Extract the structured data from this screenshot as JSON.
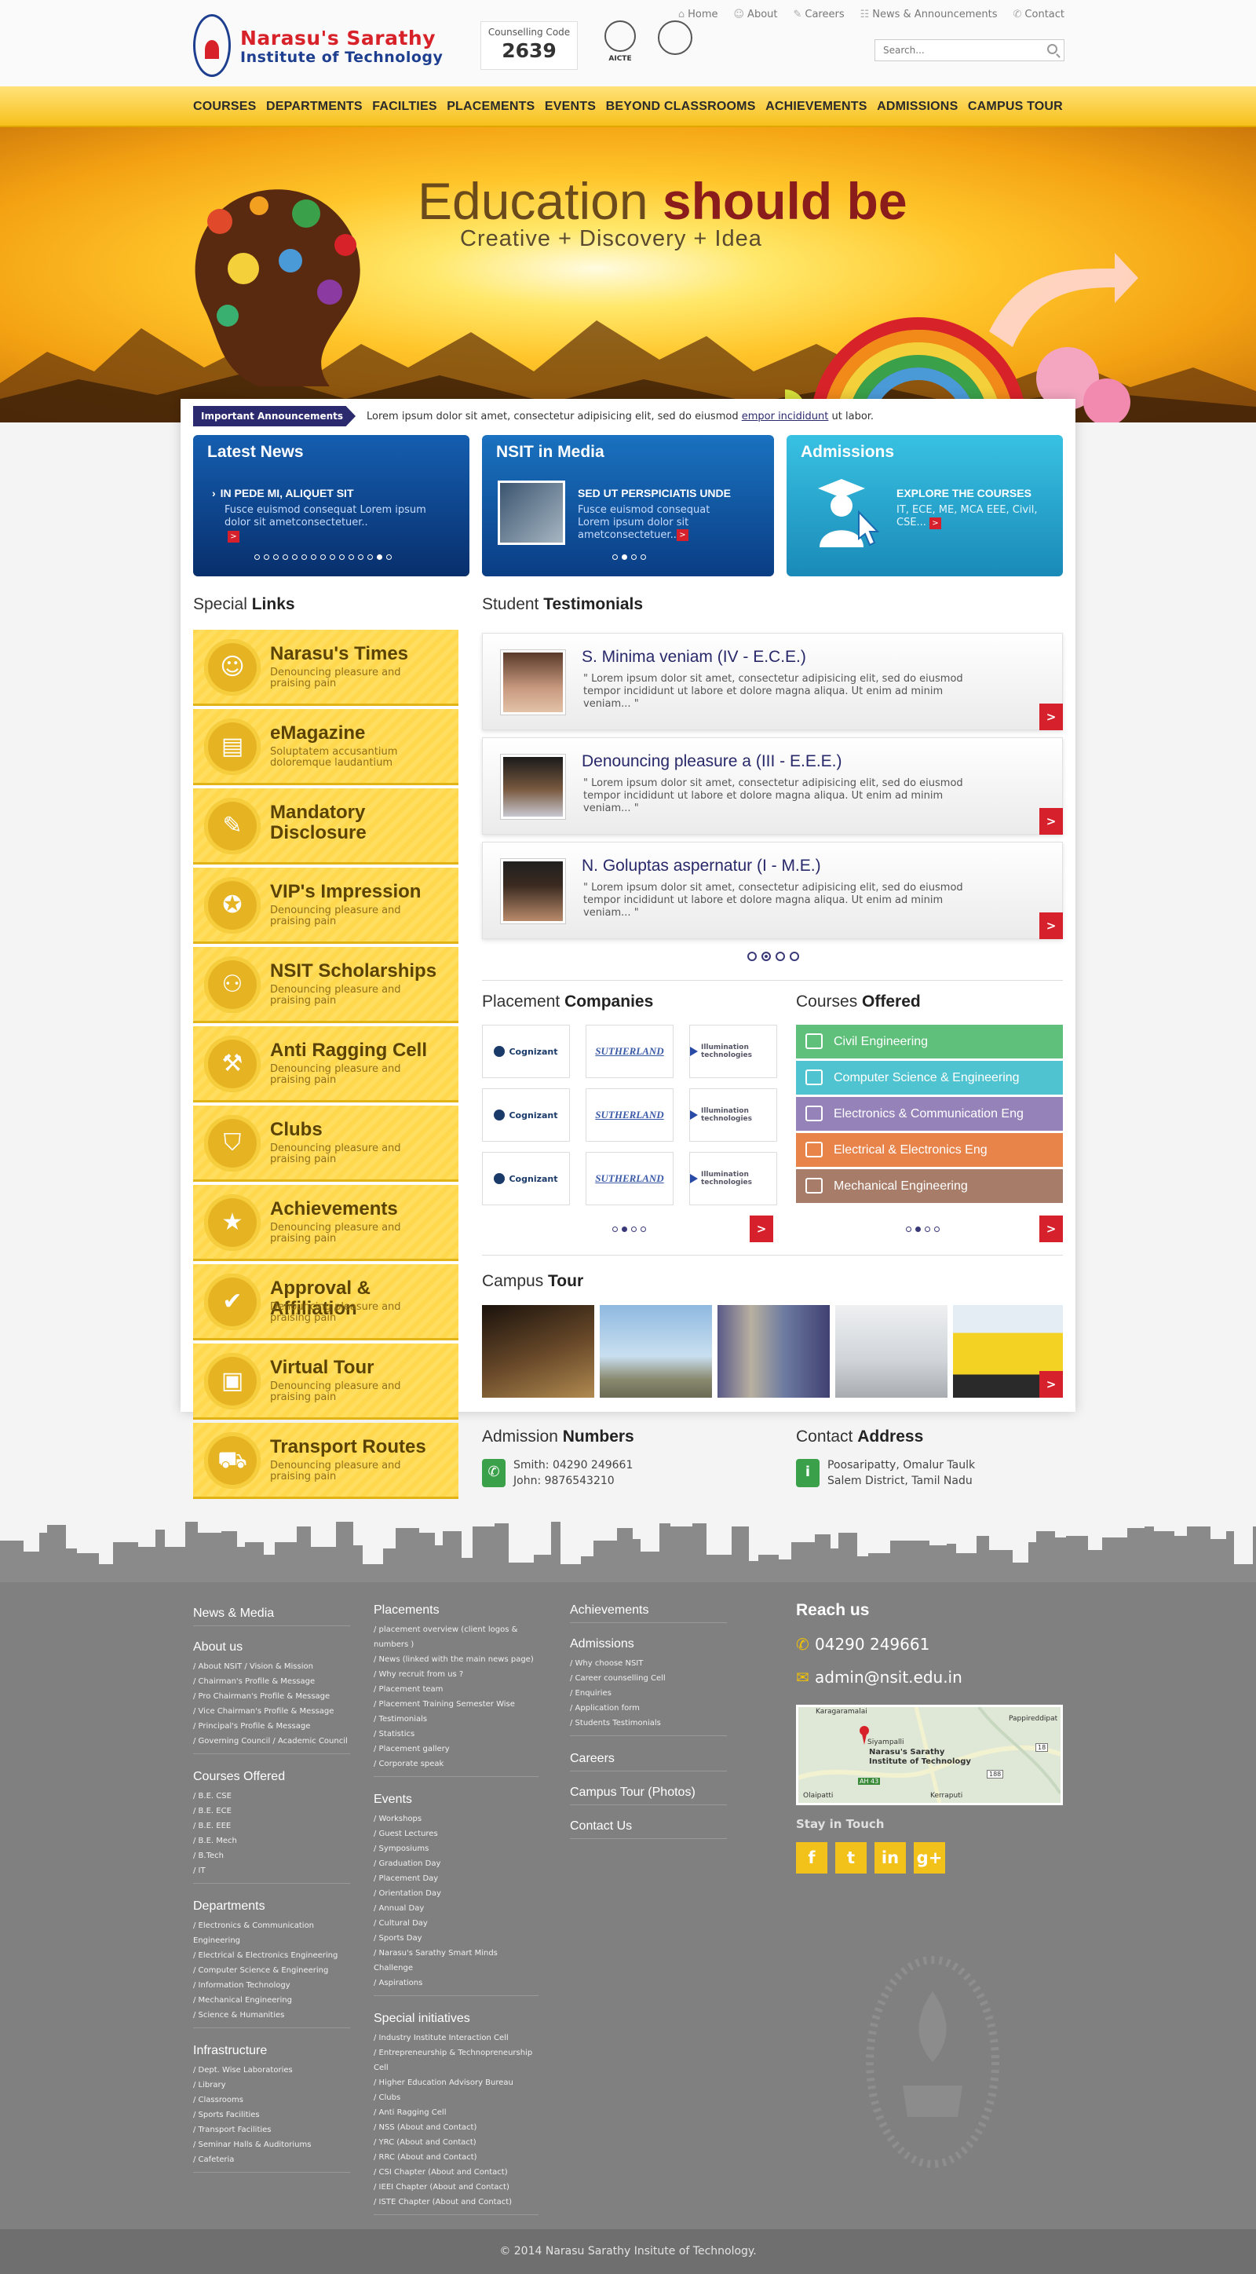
{
  "header": {
    "logo_line1": "Narasu's Sarathy",
    "logo_line2": "Institute of Technology",
    "counselling_label": "Counselling Code",
    "counselling_code": "2639",
    "seal_aicte": "AICTE",
    "top_links": [
      "Home",
      "About",
      "Careers",
      "News & Announcements",
      "Contact"
    ],
    "search_placeholder": "Search..."
  },
  "nav": [
    "COURSES",
    "DEPARTMENTS",
    "FACILTIES",
    "PLACEMENTS",
    "EVENTS",
    "BEYOND CLASSROOMS",
    "ACHIEVEMENTS",
    "ADMISSIONS",
    "CAMPUS TOUR"
  ],
  "hero": {
    "title_plain": "Education ",
    "title_bold": "should be",
    "subtitle": "Creative   +   Discovery   +   Idea"
  },
  "announcement": {
    "tag": "Important Announcements",
    "text_before": "Lorem ipsum dolor sit amet, consectetur adipisicing elit, sed do eiusmod ",
    "link": "empor incididunt",
    "text_after": " ut labor."
  },
  "panels": {
    "news": {
      "title": "Latest News",
      "item_title": "IN PEDE MI, ALIQUET SIT",
      "item_text": "Fusce euismod consequat Lorem ipsum dolor sit ametconsectetuer..",
      "more": ">",
      "dot_count": 15,
      "active_dot": 13
    },
    "media": {
      "title": "NSIT in Media",
      "item_title": "SED UT PERSPICIATIS UNDE",
      "item_text": "Fusce euismod consequat Lorem ipsum dolor sit ametconsectetuer..",
      "more": ">",
      "dot_count": 4,
      "active_dot": 1
    },
    "admissions": {
      "title": "Admissions",
      "item_title": "EXPLORE THE COURSES",
      "item_text": "IT, ECE, ME, MCA EEE, Civil, CSE...",
      "more": ">"
    }
  },
  "special_links": {
    "title_plain": "Special ",
    "title_bold": "Links",
    "items": [
      {
        "title": "Narasu's Times",
        "desc": "Denouncing pleasure and praising pain",
        "icon": "person-icon"
      },
      {
        "title": "eMagazine",
        "desc": "Soluptatem accusantium doloremque laudantium",
        "icon": "document-icon"
      },
      {
        "title": "Mandatory Disclosure",
        "desc": "",
        "icon": "edit-icon"
      },
      {
        "title": "VIP's Impression",
        "desc": "Denouncing pleasure and praising pain",
        "icon": "badge-icon"
      },
      {
        "title": "NSIT Scholarships",
        "desc": "Denouncing pleasure and praising pain",
        "icon": "scholarship-icon"
      },
      {
        "title": "Anti Ragging Cell",
        "desc": "Denouncing pleasure and praising pain",
        "icon": "gavel-icon"
      },
      {
        "title": "Clubs",
        "desc": "Denouncing pleasure and praising pain",
        "icon": "shield-icon"
      },
      {
        "title": "Achievements",
        "desc": "Denouncing pleasure and praising pain",
        "icon": "trophy-icon"
      },
      {
        "title": "Approval & Affiliation",
        "desc": "Denouncing pleasure and praising pain",
        "icon": "check-icon"
      },
      {
        "title": "Virtual Tour",
        "desc": "Denouncing pleasure and praising pain",
        "icon": "camera-icon"
      },
      {
        "title": "Transport Routes",
        "desc": "Denouncing pleasure and praising pain",
        "icon": "bus-icon"
      }
    ]
  },
  "testimonials": {
    "title_plain": "Student ",
    "title_bold": "Testimonials",
    "items": [
      {
        "name": "S. Minima veniam (IV - E.C.E.)",
        "quote": "\" Lorem ipsum dolor sit amet, consectetur adipisicing elit, sed do eiusmod tempor incididunt ut labore et dolore magna aliqua. Ut enim ad minim veniam... \""
      },
      {
        "name": "Denouncing pleasure a (III - E.E.E.)",
        "quote": "\" Lorem ipsum dolor sit amet, consectetur adipisicing elit, sed do eiusmod tempor incididunt ut labore et dolore magna aliqua. Ut enim ad minim veniam... \""
      },
      {
        "name": "N. Goluptas aspernatur (I - M.E.)",
        "quote": "\" Lorem ipsum dolor sit amet, consectetur adipisicing elit, sed do eiusmod tempor incididunt ut labore et dolore magna aliqua. Ut enim ad minim veniam... \""
      }
    ],
    "more": ">",
    "dot_count": 4,
    "active_dot": 1
  },
  "placement": {
    "title_plain": "Placement ",
    "title_bold": "Companies",
    "logos": [
      "Cognizant",
      "SUTHERLAND",
      "Illumination technologies",
      "Cognizant",
      "SUTHERLAND",
      "Illumination technologies",
      "Cognizant",
      "SUTHERLAND",
      "Illumination technologies"
    ],
    "more": ">",
    "dot_count": 4,
    "active_dot": 1
  },
  "courses": {
    "title_plain": "Courses ",
    "title_bold": "Offered",
    "items": [
      {
        "name": "Civil Engineering",
        "color": "#5ec07a"
      },
      {
        "name": "Computer Science & Engineering",
        "color": "#4fc3cf"
      },
      {
        "name": "Electronics & Communication Eng",
        "color": "#9582b9"
      },
      {
        "name": "Electrical & Electronics Eng",
        "color": "#e8834a"
      },
      {
        "name": "Mechanical Engineering",
        "color": "#a77d6a"
      }
    ],
    "more": ">",
    "dot_count": 4,
    "active_dot": 1
  },
  "campus_tour": {
    "title_plain": "Campus ",
    "title_bold": "Tour",
    "more": ">"
  },
  "admission_numbers": {
    "title_plain": "Admission ",
    "title_bold": "Numbers",
    "line1": "Smith: 04290 249661",
    "line2": "John: 9876543210"
  },
  "contact_address": {
    "title_plain": "Contact ",
    "title_bold": "Address",
    "line1": "Poosaripatty, Omalur Taulk",
    "line2": "Salem District, Tamil Nadu"
  },
  "footer": {
    "col1": [
      {
        "heading": "News & Media",
        "links": []
      },
      {
        "heading": "About us",
        "links": [
          "/ About NSIT   / Vision & Mission",
          "/ Chairman's Profile & Message",
          "/ Pro Chairman's Profile & Message",
          "/ Vice Chairman's Profile & Message",
          "/ Principal's Profile & Message",
          "/ Governing Council   / Academic Council"
        ]
      },
      {
        "heading": "Courses Offered",
        "links": [
          "/ B.E. CSE",
          "/ B.E. ECE",
          "/ B.E. EEE",
          "/ B.E. Mech",
          "/ B.Tech",
          "/ IT"
        ]
      },
      {
        "heading": "Departments",
        "links": [
          "/ Electronics & Communication Engineering",
          "/ Electrical & Electronics Engineering",
          "/ Computer Science & Engineering",
          "/ Information Technology",
          "/ Mechanical Engineering",
          "/ Science & Humanities"
        ]
      },
      {
        "heading": "Infrastructure",
        "links": [
          "/ Dept. Wise Laboratories",
          "/ Library",
          "/ Classrooms",
          "/ Sports Facilities",
          "/ Transport Facilities",
          "/ Seminar Halls & Auditoriums",
          "/ Cafeteria"
        ]
      }
    ],
    "col2": [
      {
        "heading": "Placements",
        "links": [
          "/ placement overview (client logos & numbers )",
          "/ News (linked with the main news page)",
          "/ Why recruit from us ?",
          "/ Placement team",
          "/ Placement Training Semester Wise",
          "/ Testimonials",
          "/ Statistics",
          "/ Placement gallery",
          "/ Corporate speak"
        ]
      },
      {
        "heading": "Events",
        "links": [
          "/ Workshops",
          "/ Guest Lectures",
          "/ Symposiums",
          "/ Graduation Day",
          "/ Placement Day",
          "/ Orientation Day",
          "/ Annual Day",
          "/ Cultural Day",
          "/ Sports Day",
          "/ Narasu's Sarathy Smart Minds Challenge",
          "/ Aspirations"
        ]
      },
      {
        "heading": "Special initiatives",
        "links": [
          "/ Industry Institute Interaction Cell",
          "/ Entrepreneurship & Technopreneurship Cell",
          "/ Higher Education Advisory Bureau",
          "/ Clubs",
          "/ Anti Ragging Cell",
          "/ NSS (About and Contact)",
          "/ YRC (About and Contact)",
          "/ RRC (About and Contact)",
          "/ CSI Chapter (About and Contact)",
          "/ IEEI Chapter (About and Contact)",
          "/ ISTE Chapter (About and Contact)"
        ]
      }
    ],
    "col3": [
      {
        "heading": "Achievements",
        "links": []
      },
      {
        "heading": "Admissions",
        "links": [
          "/ Why choose NSIT",
          "/ Career counselling Cell",
          "/ Enquiries",
          "/ Application form",
          "/ Students Testimonials"
        ]
      },
      {
        "heading": "Careers",
        "links": []
      },
      {
        "heading": "Campus Tour (Photos)",
        "links": []
      },
      {
        "heading": "Contact Us",
        "links": []
      }
    ],
    "reach_title": "Reach us",
    "phone": "04290 249661",
    "email": "admin@nsit.edu.in",
    "map_labels": [
      "Karagaramalai",
      "Pappireddipat",
      "Narasu's Sarathy Institute of Technology",
      "Olaipatti",
      "Kerraputi",
      "Siyampalli",
      "AH 43",
      "18",
      "188"
    ],
    "stay_in_touch": "Stay in Touch",
    "social": [
      "f",
      "t",
      "in",
      "g+"
    ],
    "copyright": "© 2014 Narasu Sarathy Insitute of Technology."
  }
}
